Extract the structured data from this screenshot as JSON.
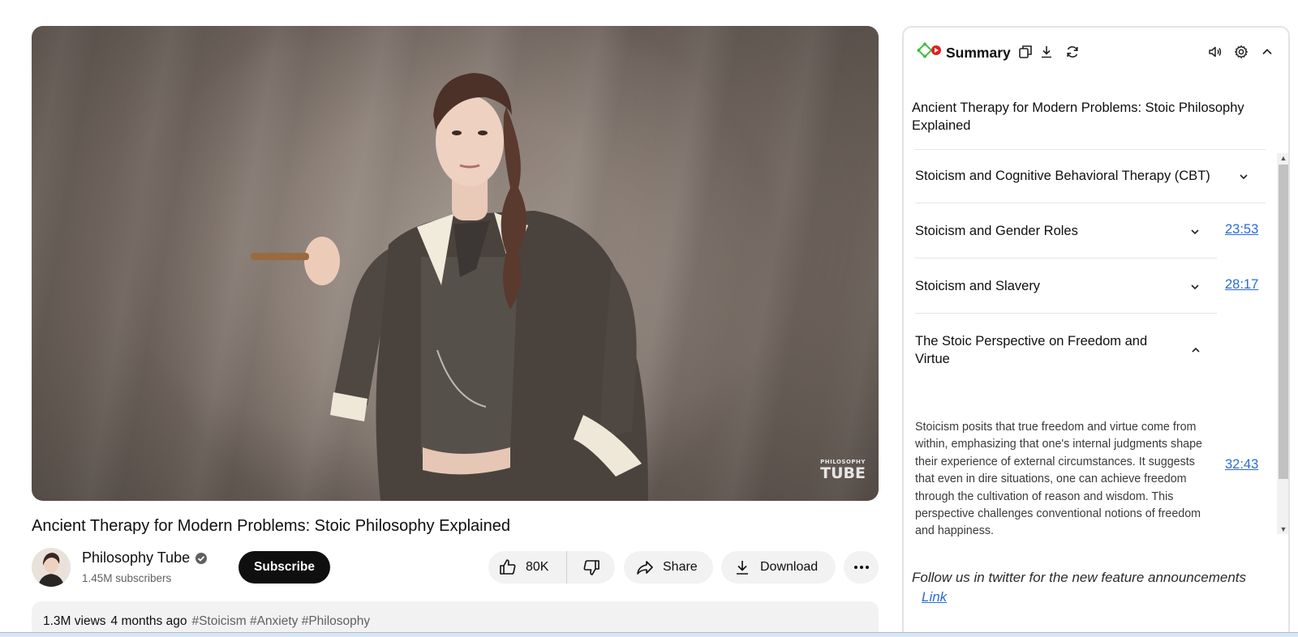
{
  "video": {
    "title": "Ancient Therapy for Modern Problems: Stoic Philosophy Explained",
    "watermark_top": "PHILOSOPHY",
    "watermark_bottom": "TUBE"
  },
  "channel": {
    "name": "Philosophy Tube",
    "subscribers": "1.45M subscribers",
    "verified": true
  },
  "actions": {
    "subscribe_label": "Subscribe",
    "like_count": "80K",
    "share_label": "Share",
    "download_label": "Download"
  },
  "description": {
    "views": "1.3M views",
    "ago": "4 months ago",
    "tags": "#Stoicism #Anxiety #Philosophy"
  },
  "summary": {
    "header_title": "Summary",
    "video_title": "Ancient Therapy for Modern Problems: Stoic Philosophy Explained",
    "sections": [
      {
        "title": "Stoicism and Cognitive Behavioral Therapy (CBT)",
        "timestamp": "",
        "expanded": false
      },
      {
        "title": "Stoicism and Gender Roles",
        "timestamp": "23:53",
        "expanded": false
      },
      {
        "title": "Stoicism and Slavery",
        "timestamp": "28:17",
        "expanded": false
      },
      {
        "title": "The Stoic Perspective on Freedom and Virtue",
        "timestamp": "32:43",
        "expanded": true,
        "body": "Stoicism posits that true freedom and virtue come from within, emphasizing that one's internal judgments shape their experience of external circumstances. It suggests that even in dire situations, one can achieve freedom through the cultivation of reason and wisdom. This perspective challenges conventional notions of freedom and happiness."
      }
    ],
    "follow_text": "Follow us in twitter for the new feature announcements",
    "follow_link": "Link"
  },
  "colors": {
    "accent_link": "#2a6bd8",
    "subscribe_bg": "#0f0f0f",
    "pill_bg": "#f2f2f2"
  },
  "icons": [
    "copy-icon",
    "download-icon",
    "refresh-icon",
    "volume-icon",
    "gear-icon",
    "chevron-up-icon",
    "like-icon",
    "dislike-icon",
    "share-icon",
    "more-icon",
    "verified-icon"
  ]
}
